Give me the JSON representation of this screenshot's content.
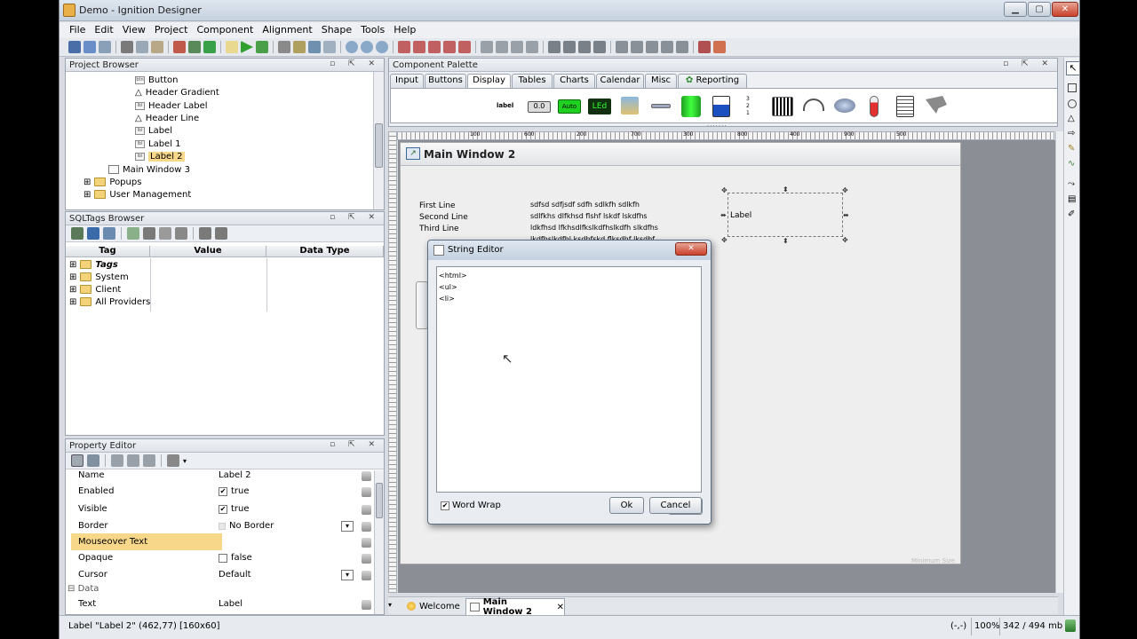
{
  "window": {
    "title": "Demo - Ignition Designer"
  },
  "menu": [
    "File",
    "Edit",
    "View",
    "Project",
    "Component",
    "Alignment",
    "Shape",
    "Tools",
    "Help"
  ],
  "project_browser": {
    "title": "Project Browser",
    "items": [
      {
        "label": "Button",
        "icon": "component-icon"
      },
      {
        "label": "Header Gradient",
        "icon": "shape-icon"
      },
      {
        "label": "Header Label",
        "icon": "label-icon"
      },
      {
        "label": "Header Line",
        "icon": "shape-icon"
      },
      {
        "label": "Label",
        "icon": "label-icon"
      },
      {
        "label": "Label 1",
        "icon": "label-icon"
      },
      {
        "label": "Label 2",
        "icon": "label-icon",
        "selected": true
      },
      {
        "label": "Main Window 3",
        "icon": "window-icon"
      },
      {
        "label": "Popups",
        "icon": "folder-icon"
      },
      {
        "label": "User Management",
        "icon": "folder-icon"
      }
    ]
  },
  "sqltags_browser": {
    "title": "SQLTags Browser",
    "columns": [
      "Tag",
      "Value",
      "Data Type"
    ],
    "rows": [
      "Tags",
      "System",
      "Client",
      "All Providers"
    ]
  },
  "property_editor": {
    "title": "Property Editor",
    "rows": [
      {
        "name": "Name",
        "value": "Label 2"
      },
      {
        "name": "Enabled",
        "value": "true",
        "checked": true
      },
      {
        "name": "Visible",
        "value": "true",
        "checked": true
      },
      {
        "name": "Border",
        "value": "No Border"
      },
      {
        "name": "Mouseover Text",
        "value": ""
      },
      {
        "name": "Opaque",
        "value": "false",
        "checked": false
      },
      {
        "name": "Cursor",
        "value": "Default"
      }
    ],
    "section": "Data",
    "text_row": {
      "name": "Text",
      "value": "Label"
    }
  },
  "palette": {
    "title": "Component Palette",
    "tabs": [
      "Input",
      "Buttons",
      "Display",
      "Tables",
      "Charts",
      "Calendar",
      "Misc",
      "Reporting"
    ],
    "active_tab": "Display",
    "icon_texts": [
      "label",
      "0.0",
      "Auto",
      "LEd"
    ]
  },
  "ruler_ticks": [
    "100",
    "200",
    "300",
    "400",
    "500",
    "600",
    "700",
    "800",
    "900"
  ],
  "canvas": {
    "window_title": "Main Window 2",
    "lines": [
      {
        "label": "First Line",
        "text": "sdfsd sdfjsdf sdfh sdlkfh sdlkfh"
      },
      {
        "label": "Second Line",
        "text": "sdlfkhs dlfkhsd flshf lskdf lskdfhs"
      },
      {
        "label": "Third Line",
        "text": "ldkfhsd lfkhsdlfkslkdfhslkdfh slkdfhs"
      },
      {
        "label": "",
        "text": "lkdfhslkdfhl ksdhfskd flksdhf lksdhf"
      }
    ],
    "selected_label": "Label",
    "watermark": "Minimum Size"
  },
  "string_editor": {
    "title": "String Editor",
    "content": [
      "<html>",
      "<ul>",
      "<li>"
    ],
    "word_wrap_label": "Word Wrap",
    "ok": "Ok",
    "cancel": "Cancel"
  },
  "doc_tabs": [
    "Welcome",
    "Main Window 2"
  ],
  "status": {
    "left": "Label \"Label 2\" (462,77) [160x60]",
    "coords": "(-,-)",
    "zoom": "100%",
    "memory": "342 / 494 mb"
  }
}
